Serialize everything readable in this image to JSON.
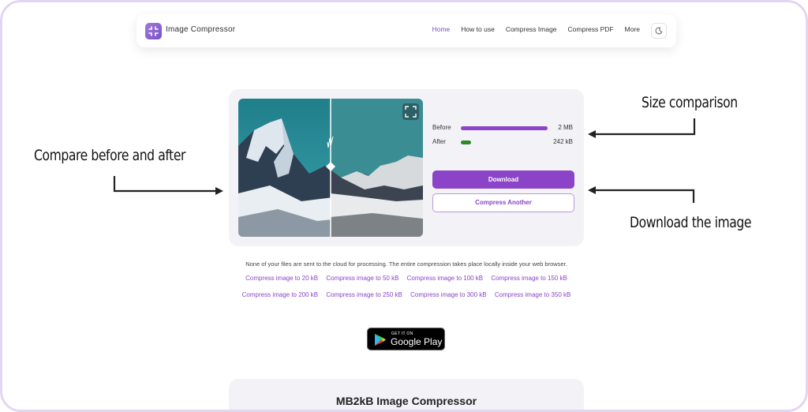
{
  "header": {
    "brand": "Image Compressor",
    "nav": [
      "Home",
      "How to use",
      "Compress Image",
      "Compress PDF",
      "More"
    ],
    "active_nav": "Home",
    "theme_icon": "moon-icon"
  },
  "compressor": {
    "stats": [
      {
        "label": "Before",
        "value": "2 MB",
        "fill": 1.0,
        "color": "#8b44c7"
      },
      {
        "label": "After",
        "value": "242 kB",
        "fill": 0.12,
        "color": "#2a8a2a"
      }
    ],
    "download_label": "Download",
    "compress_another_label": "Compress Another"
  },
  "privacy_text": "None of your files are sent to the cloud for processing. The entire compression takes place locally inside your web browser.",
  "size_links": [
    [
      "Compress image to 20 kB",
      "Compress image to 50 kB",
      "Compress image to 100 kB",
      "Compress image to 150 kB"
    ],
    [
      "Compress image to 200 kB",
      "Compress image to 250 kB",
      "Compress image to 300 kB",
      "Compress image to 350 kB"
    ]
  ],
  "google_play": {
    "small": "GET IT ON",
    "big": "Google Play"
  },
  "bottom_title": "MB2kB Image Compressor",
  "annotations": {
    "compare": "Compare before and after",
    "size": "Size comparison",
    "download": "Download the image"
  },
  "colors": {
    "accent": "#8b44c7",
    "after_bar": "#2a8a2a",
    "frame": "#e3d6f3"
  }
}
